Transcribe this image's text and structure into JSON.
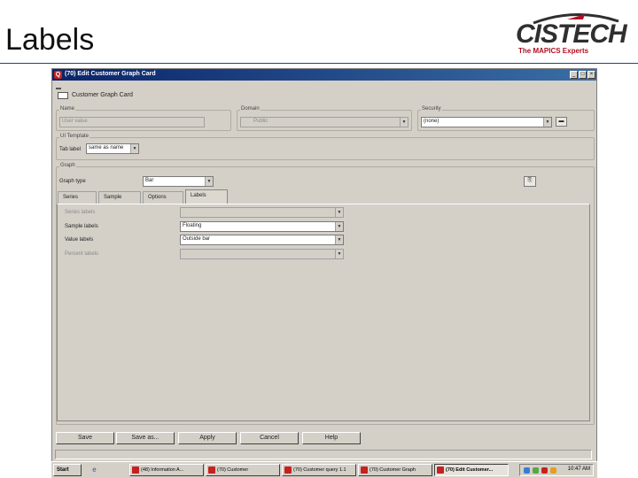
{
  "slide": {
    "title": "Labels",
    "logo_word": "CISTECH",
    "logo_tagline": "The MAPICS Experts"
  },
  "window": {
    "title": "(70) Edit Customer Graph Card",
    "icon_letter": "Q",
    "controls": [
      "_",
      "□",
      "×"
    ]
  },
  "card": {
    "title": "Customer Graph Card"
  },
  "top_fields": {
    "name_label": "Name",
    "name_value": "User value",
    "domain_label": "Domain",
    "domain_value": "Public",
    "security_label": "Security",
    "security_value": "(none)"
  },
  "ui_template": {
    "group_label": "UI Template",
    "tab_label_label": "Tab label",
    "tab_label_value": "same as name"
  },
  "graph": {
    "group_label": "Graph",
    "graph_type_label": "Graph type",
    "graph_type_value": "Bar"
  },
  "tabs": [
    {
      "label": "Series"
    },
    {
      "label": "Sample"
    },
    {
      "label": "Options"
    },
    {
      "label": "Labels",
      "active": true
    }
  ],
  "labels_panel": {
    "rows": [
      {
        "label": "Series labels",
        "value": "",
        "enabled": false
      },
      {
        "label": "Sample labels",
        "value": "Floating",
        "enabled": true
      },
      {
        "label": "Value labels",
        "value": "Outside bar",
        "enabled": true
      },
      {
        "label": "Percent labels",
        "value": "",
        "enabled": false
      }
    ]
  },
  "buttons": {
    "save": "Save",
    "save_as": "Save as...",
    "apply": "Apply",
    "cancel": "Cancel",
    "help": "Help"
  },
  "taskbar": {
    "start": "Start",
    "items": [
      {
        "label": "(48) Information A...",
        "active": false
      },
      {
        "label": "(70) Customer",
        "active": false
      },
      {
        "label": "(70) Customer query 1.1",
        "active": false
      },
      {
        "label": "(70) Customer Graph",
        "active": false
      },
      {
        "label": "(70) Edit Customer...",
        "active": true
      }
    ],
    "clock": "10:47 AM"
  },
  "colors": {
    "window_bg": "#d4d0c8",
    "titlebar": "#0a246a",
    "brand_red": "#b01020",
    "header_rule": "#2a3f7a"
  }
}
